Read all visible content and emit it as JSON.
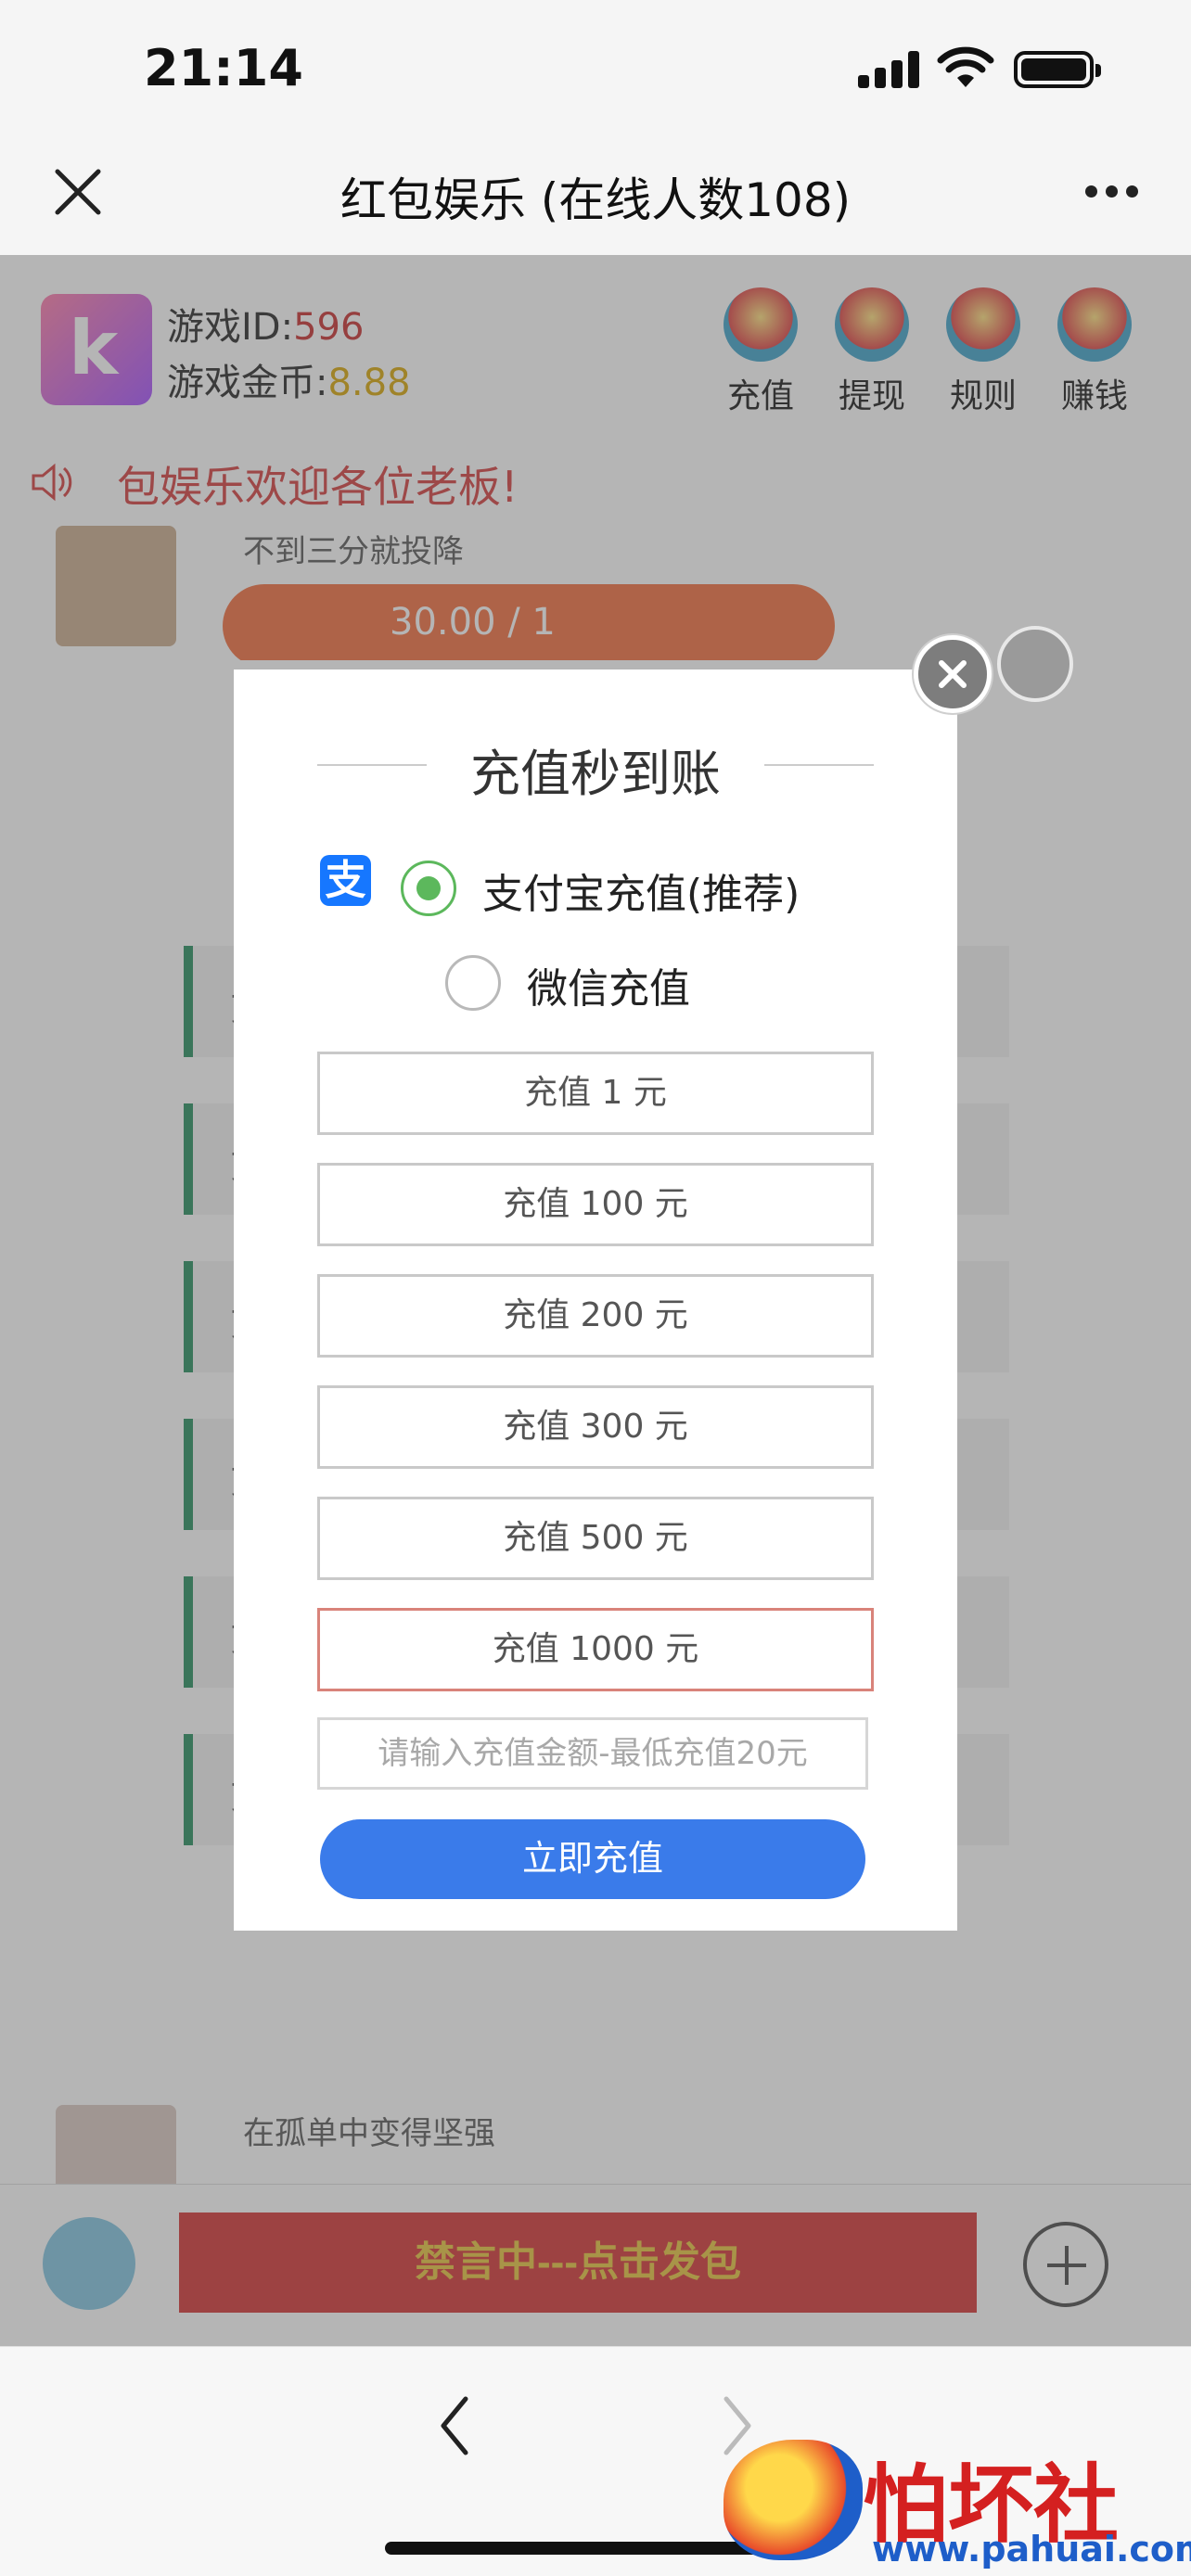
{
  "status_bar": {
    "time": "21:14"
  },
  "nav": {
    "title": "红包娱乐 (在线人数108)"
  },
  "header": {
    "game_id_label": "游戏ID:",
    "game_id_value": "596",
    "coins_label": "游戏金币:",
    "coins_value": "8.88",
    "actions": [
      {
        "label": "充值",
        "icon": "recharge-icon"
      },
      {
        "label": "提现",
        "icon": "withdraw-icon"
      },
      {
        "label": "规则",
        "icon": "rules-icon"
      },
      {
        "label": "赚钱",
        "icon": "earn-icon"
      }
    ]
  },
  "marquee": {
    "text": "包娱乐欢迎各位老板!"
  },
  "chat": [
    {
      "name": "不到三分就投降",
      "bubble": "30.00 / 1"
    },
    {
      "name": "在孤单中变得坚强",
      "bubble": ""
    }
  ],
  "bottom_bar": {
    "send_label": "禁言中---点击发包"
  },
  "modal": {
    "title": "充值秒到账",
    "pay_methods": [
      {
        "label": "支付宝充值(推荐)",
        "selected": true,
        "icon": "alipay-icon"
      },
      {
        "label": "微信充值",
        "selected": false
      }
    ],
    "amounts": [
      {
        "label": "充值 1 元",
        "selected": false
      },
      {
        "label": "充值 100 元",
        "selected": false
      },
      {
        "label": "充值 200 元",
        "selected": false
      },
      {
        "label": "充值 300 元",
        "selected": false
      },
      {
        "label": "充值 500 元",
        "selected": false
      },
      {
        "label": "充值 1000 元",
        "selected": true
      }
    ],
    "custom_placeholder": "请输入充值金额-最低充值20元",
    "submit_label": "立即充值"
  },
  "watermark": {
    "text": "怕坏社区",
    "url": "www.pahuai.com"
  },
  "colors": {
    "accent_blue": "#3a7bea",
    "alipay_blue": "#1677ff",
    "radio_green": "#5cb85c",
    "send_red": "#d32f2f"
  }
}
